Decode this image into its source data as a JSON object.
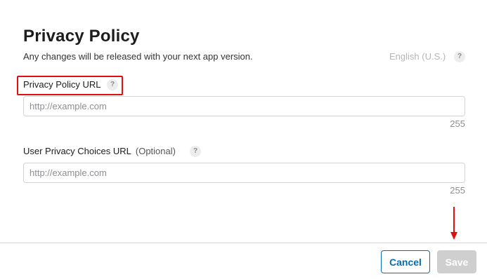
{
  "header": {
    "title": "Privacy Policy",
    "subtitle": "Any changes will be released with your next app version.",
    "locale": "English (U.S.)",
    "help_glyph": "?"
  },
  "fields": [
    {
      "label": "Privacy Policy URL",
      "optional": "",
      "placeholder": "http://example.com",
      "value": "",
      "counter": "255"
    },
    {
      "label": "User Privacy Choices URL",
      "optional": "(Optional)",
      "placeholder": "http://example.com",
      "value": "",
      "counter": "255"
    }
  ],
  "footer": {
    "cancel_label": "Cancel",
    "save_label": "Save"
  },
  "annotations": {
    "highlight_color": "#e01010",
    "arrow_color": "#e01010"
  },
  "colors": {
    "accent": "#0a6bb0",
    "disabled_button": "#cfcfcf"
  }
}
